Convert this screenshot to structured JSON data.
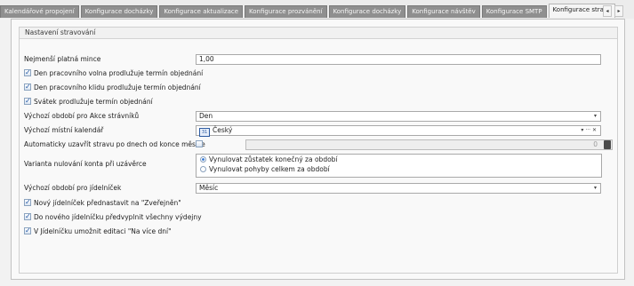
{
  "tabs": [
    {
      "label": "Kalendářové propojení",
      "active": false
    },
    {
      "label": "Konfigurace docházky",
      "active": false
    },
    {
      "label": "Konfigurace aktualizace",
      "active": false
    },
    {
      "label": "Konfigurace prozvánění",
      "active": false
    },
    {
      "label": "Konfigurace docházky",
      "active": false
    },
    {
      "label": "Konfigurace návštěv",
      "active": false
    },
    {
      "label": "Konfigurace SMTP",
      "active": false
    },
    {
      "label": "Konfigurace stravo",
      "active": true
    }
  ],
  "group": {
    "title": "Nastavení stravování"
  },
  "fields": {
    "min_coin": {
      "label": "Nejmenší platná mince",
      "value": "1,00"
    },
    "weekend_extends": {
      "label": "Den pracovního volna prodlužuje termín objednání",
      "checked": true
    },
    "workday_extends": {
      "label": "Den pracovního klidu prodlužuje termín objednání",
      "checked": true
    },
    "holiday_extends": {
      "label": "Svátek prodlužuje termín objednání",
      "checked": true
    },
    "default_period_actions": {
      "label": "Výchozí období pro Akce strávníků",
      "value": "Den"
    },
    "default_calendar": {
      "label": "Výchozí místní kalendář",
      "value": "Český",
      "actions": "▾ ··· ✕"
    },
    "auto_close": {
      "label": "Automaticky uzavřít stravu po dnech od konce měsíce",
      "checked": false,
      "value": "0"
    },
    "reset_variant": {
      "label": "Varianta nulování konta při uzávěrce",
      "options": [
        {
          "label": "Vynulovat zůstatek konečný za období",
          "selected": true
        },
        {
          "label": "Vynulovat pohyby celkem za období",
          "selected": false
        }
      ]
    },
    "default_period_menu": {
      "label": "Výchozí období pro jídelníček",
      "value": "Měsíc"
    },
    "new_menu_published": {
      "label": "Nový jídelníček přednastavit na \"Zveřejněn\"",
      "checked": true
    },
    "prefill_dispensaries": {
      "label": "Do nového jídelníčku předvyplnit všechny výdejny",
      "checked": true
    },
    "multi_day_edit": {
      "label": "V Jídelníčku umožnit editaci \"Na více dní\"",
      "checked": true
    }
  },
  "icons": {
    "scroll_left": "◂",
    "scroll_right": "▸",
    "dropdown": "▾",
    "calendar": "calendar-icon"
  }
}
